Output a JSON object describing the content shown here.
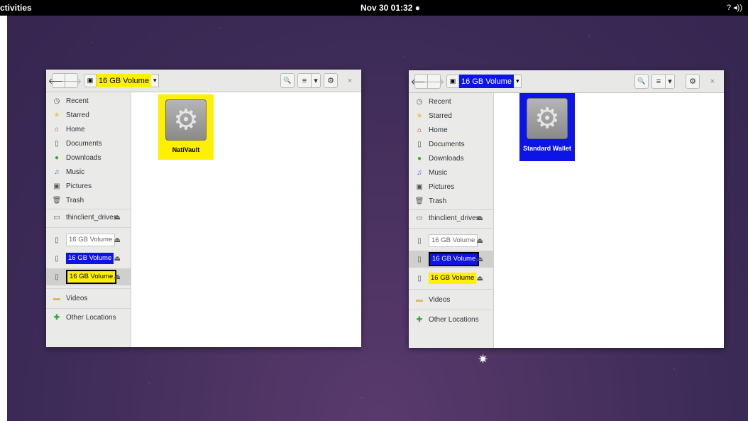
{
  "topbar": {
    "activities": "ctivities",
    "clock": "Nov 30 01:32",
    "record_dot": "●",
    "tray": "?  ◂))"
  },
  "icons": {
    "back": "🡐",
    "forward": "🡒",
    "drive": "▣",
    "dropdown": "▾",
    "search": "🔍",
    "list": "≡",
    "gear": "⚙",
    "close": "×",
    "eject": "⏏",
    "sparkle": "✷"
  },
  "sidebar": {
    "places": [
      "Recent",
      "Starred",
      "Home",
      "Documents",
      "Downloads",
      "Music",
      "Pictures",
      "Trash"
    ],
    "thinclient": "thinclient_drives",
    "volumes": [
      "16 GB Volume",
      "16 GB Volume",
      "16 GB Volume"
    ],
    "videos": "Videos",
    "other": "Other Locations"
  },
  "windows": [
    {
      "path_label": "16 GB Volume",
      "item_label": "NatiVault",
      "item_highlight": "#ffef00"
    },
    {
      "path_label": "16 GB Volume",
      "item_label": "Standard Wallet",
      "item_highlight": "#0d14e6"
    }
  ]
}
